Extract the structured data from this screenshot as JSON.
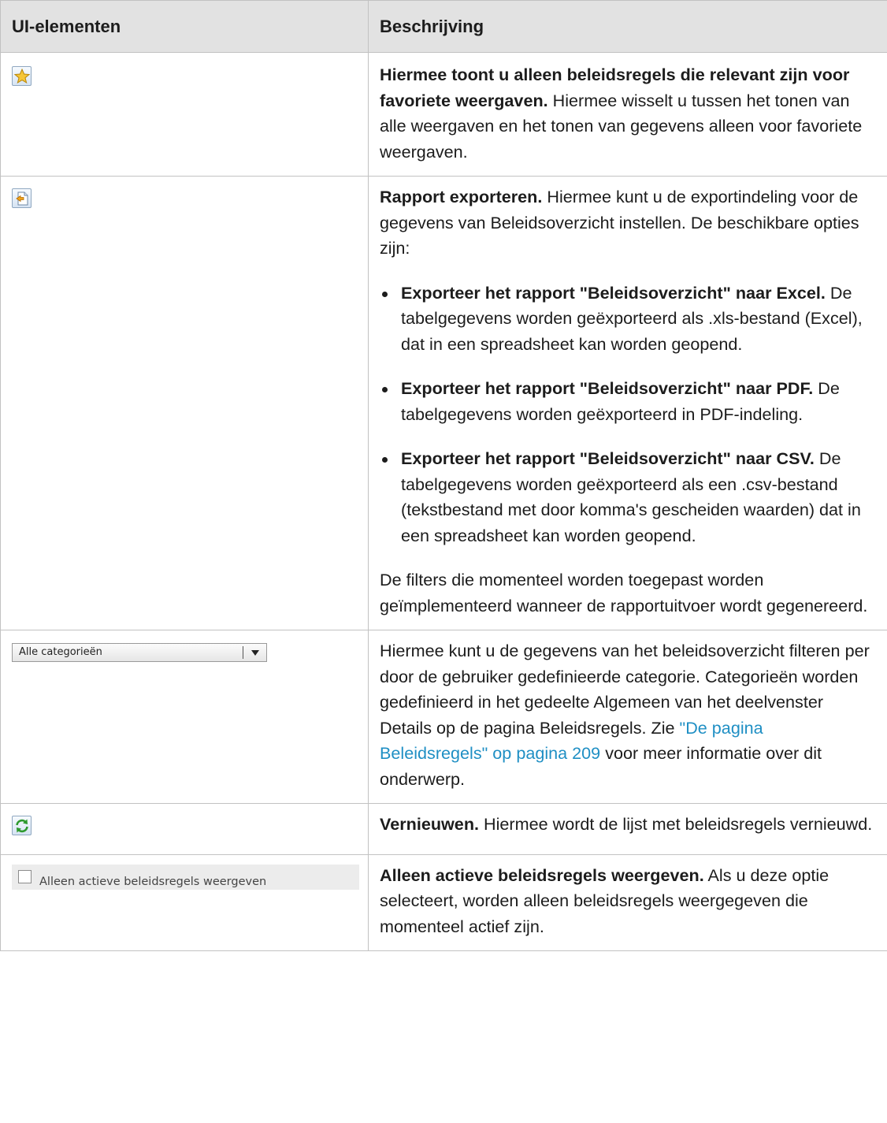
{
  "header": {
    "col1": "UI-elementen",
    "col2": "Beschrijving"
  },
  "rows": {
    "favorites": {
      "icon": "star-favorites-icon",
      "bold": "Hiermee toont u alleen beleidsregels die relevant zijn voor favoriete weergaven.",
      "text": " Hiermee wisselt u tussen het tonen van alle weergaven en het tonen van gegevens alleen voor favoriete weergaven."
    },
    "export": {
      "icon": "export-report-icon",
      "bold": "Rapport exporteren.",
      "text": " Hiermee kunt u de exportindeling voor de gegevens van Beleidsoverzicht instellen. De beschikbare opties zijn:",
      "options": [
        {
          "bold": "Exporteer het rapport \"Beleidsoverzicht\" naar Excel.",
          "text": " De tabelgegevens worden geëxporteerd als .xls-bestand (Excel), dat in een spreadsheet kan worden geopend."
        },
        {
          "bold": "Exporteer het rapport \"Beleidsoverzicht\" naar PDF.",
          "text": " De tabelgegevens worden geëxporteerd in PDF-indeling."
        },
        {
          "bold": "Exporteer het rapport \"Beleidsoverzicht\" naar CSV.",
          "text": " De tabelgegevens worden geëxporteerd als een .csv-bestand (tekstbestand met door komma's gescheiden waarden) dat in een spreadsheet kan worden geopend."
        }
      ],
      "footer": "De filters die momenteel worden toegepast worden geïmplementeerd wanneer de rapportuitvoer wordt gegenereerd."
    },
    "category": {
      "dropdown_value": "Alle categorieën",
      "text_before": "Hiermee kunt u de gegevens van het beleidsoverzicht filteren per door de gebruiker gedefinieerde categorie. Categorieën worden gedefinieerd in het gedeelte Algemeen van het deelvenster Details op de pagina Beleidsregels. Zie ",
      "link": "\"De pagina Beleidsregels\" op pagina 209",
      "text_after": " voor meer informatie over dit onderwerp."
    },
    "refresh": {
      "icon": "refresh-icon",
      "bold": "Vernieuwen.",
      "text": " Hiermee wordt de lijst met beleidsregels vernieuwd."
    },
    "active_only": {
      "checkbox_label": "Alleen actieve beleidsregels weergeven",
      "checked": false,
      "bold": "Alleen actieve beleidsregels weergeven.",
      "text": " Als u deze optie selecteert, worden alleen beleidsregels weergegeven die momenteel actief zijn."
    }
  },
  "colors": {
    "header_bg": "#e2e2e2",
    "border": "#c2c2c2",
    "link": "#1f8fc4"
  }
}
